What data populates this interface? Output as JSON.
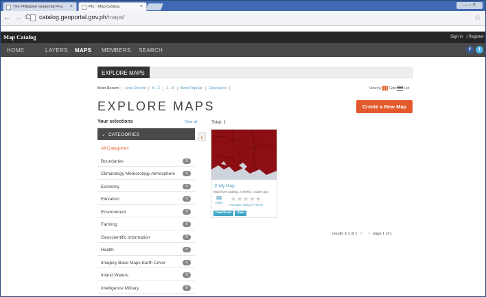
{
  "browser": {
    "tabs": [
      {
        "title": "The Philippine Geoportal Proj"
      },
      {
        "title": "PG :: Map Catalog"
      }
    ],
    "url_domain": "catalog.geoportal.gov.ph",
    "url_path": "/maps/"
  },
  "site": {
    "brand": "Map Catalog",
    "signin": "Sign in",
    "separator": "|",
    "register": "Register",
    "nav": [
      "HOME",
      "LAYERS",
      "MAPS",
      "MEMBERS",
      "SEARCH"
    ],
    "active_nav": "MAPS",
    "social": [
      {
        "icon": "facebook-icon",
        "glyph": "f",
        "color": "#3b5998"
      },
      {
        "icon": "twitter-icon",
        "glyph": "t",
        "color": "#4ab3e8"
      }
    ]
  },
  "page": {
    "tab_label": "EXPLORE MAPS",
    "sort_options": [
      "Most Recent",
      "Less Recent",
      "A - Z",
      "Z - A",
      "Most Popular",
      "Relevance"
    ],
    "view_by": "View by",
    "view_grid": "Grid",
    "view_list": "List",
    "heading": "EXPLORE MAPS",
    "create_button": "Create a New Map",
    "your_selections": "Your selections",
    "clear_all": "Clear all",
    "total": "Total: 1",
    "categories_header": "CATEGORIES",
    "categories": [
      {
        "label": "All Categories",
        "count": null
      },
      {
        "label": "Boundaries",
        "count": "0"
      },
      {
        "label": "Climatology Meteorology Atmosphere",
        "count": "0"
      },
      {
        "label": "Economy",
        "count": "0"
      },
      {
        "label": "Elevation",
        "count": "0"
      },
      {
        "label": "Environment",
        "count": "0"
      },
      {
        "label": "Farming",
        "count": "0"
      },
      {
        "label": "Geoscientific Information",
        "count": "0"
      },
      {
        "label": "Health",
        "count": "0"
      },
      {
        "label": "Imagery Base Maps Earth Cover",
        "count": "0"
      },
      {
        "label": "Inland Waters",
        "count": "0"
      },
      {
        "label": "Intelligence Military",
        "count": "0"
      }
    ],
    "map_card": {
      "name": "My Map",
      "subtitle": "Map from catalog, 2 weeks, 4 days ago",
      "views": "88",
      "views_label": "views",
      "rating": "Average rating (0 votes)",
      "download": "Download",
      "view": "View"
    },
    "pager": {
      "results": "results 1-1 of 1",
      "prev": "<",
      "next": ">",
      "page": "page 1 of 1"
    },
    "colors": {
      "accent": "#e4592b",
      "link": "#4a98c0",
      "thumbnail": "#8b0f13"
    }
  }
}
